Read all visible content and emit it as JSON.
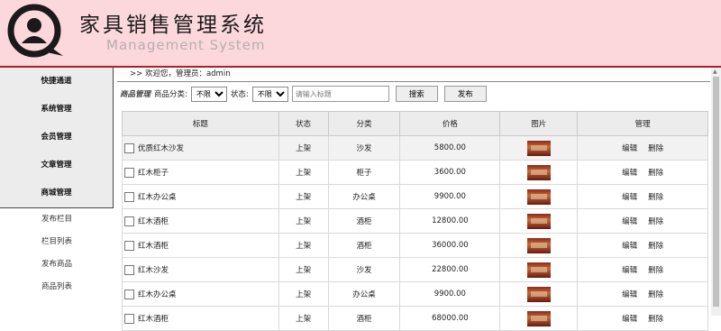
{
  "header": {
    "title_cn": "家具销售管理系统",
    "title_en": "Management System"
  },
  "sidebar": {
    "main_items": [
      "快捷通道",
      "系统管理",
      "会员管理",
      "文章管理",
      "商城管理"
    ],
    "sub_items": [
      "发布栏目",
      "栏目列表",
      "发布商品",
      "商品列表"
    ]
  },
  "welcome": ">> 欢迎您，管理员：admin",
  "toolbar": {
    "section_label": "商品管理",
    "category_label": "商品分类:",
    "category_value": "不限",
    "status_label": "状态:",
    "status_value": "不限",
    "search_placeholder": "请输入标题",
    "search_button": "搜索",
    "publish_button": "发布"
  },
  "table": {
    "headers": [
      "标题",
      "状态",
      "分类",
      "价格",
      "图片",
      "管理"
    ],
    "edit_label": "编辑",
    "delete_label": "删除",
    "rows": [
      {
        "title": "优质红木沙发",
        "status": "上架",
        "category": "沙发",
        "price": "5800.00"
      },
      {
        "title": "红木柜子",
        "status": "上架",
        "category": "柜子",
        "price": "3600.00"
      },
      {
        "title": "红木办公桌",
        "status": "上架",
        "category": "办公桌",
        "price": "9900.00"
      },
      {
        "title": "红木酒柜",
        "status": "上架",
        "category": "酒柜",
        "price": "12800.00"
      },
      {
        "title": "红木酒柜",
        "status": "上架",
        "category": "酒柜",
        "price": "36000.00"
      },
      {
        "title": "红木沙发",
        "status": "上架",
        "category": "沙发",
        "price": "22800.00"
      },
      {
        "title": "红木办公桌",
        "status": "上架",
        "category": "办公桌",
        "price": "9900.00"
      },
      {
        "title": "红木酒柜",
        "status": "上架",
        "category": "酒柜",
        "price": "68000.00"
      }
    ]
  },
  "colors": {
    "header_bg": "#fcd8dc",
    "accent": "#b01e2a"
  }
}
